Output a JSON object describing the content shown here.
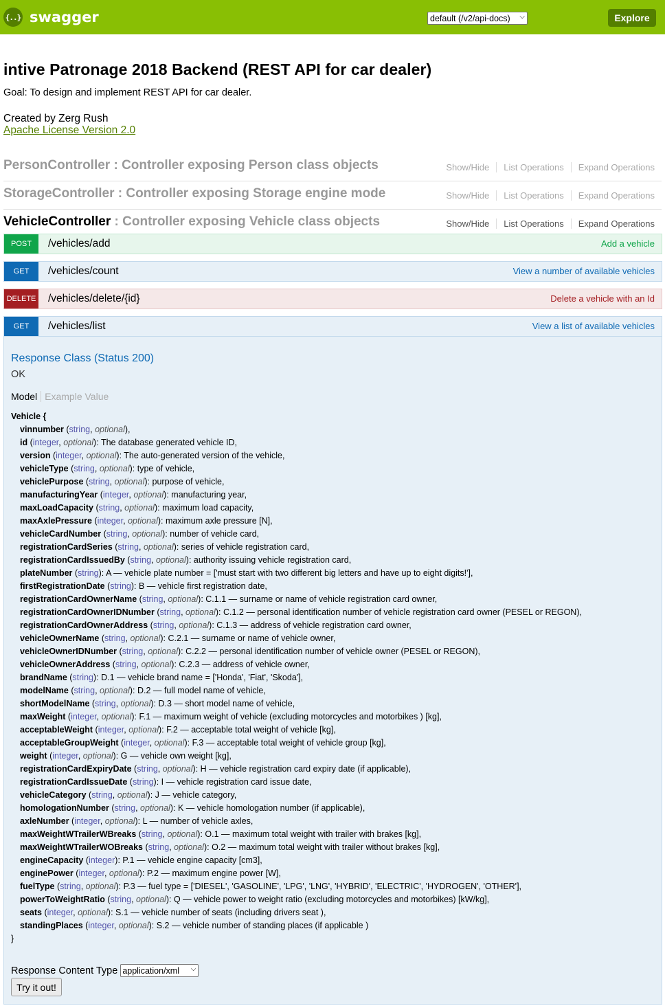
{
  "header": {
    "logo_icon_text": "{..}",
    "logo_text": "swagger",
    "api_select_value": "default (/v2/api-docs)",
    "explore_label": "Explore",
    "brand_color": "#89bf04"
  },
  "info": {
    "title": "intive Patronage 2018 Backend (REST API for car dealer)",
    "goal": "Goal: To design and implement REST API for car dealer.",
    "created_by": "Created by Zerg Rush",
    "license": "Apache License Version 2.0"
  },
  "controller_links": {
    "show_hide": "Show/Hide",
    "list_ops": "List Operations",
    "expand_ops": "Expand Operations"
  },
  "controllers": [
    {
      "name": "PersonController",
      "desc": " : Controller exposing Person class objects"
    },
    {
      "name": "StorageController",
      "desc": " : Controller exposing Storage engine mode"
    },
    {
      "name": "VehicleController",
      "desc": " : Controller exposing Vehicle class objects"
    }
  ],
  "operations": [
    {
      "method": "POST",
      "path": "/vehicles/add",
      "summary": "Add a vehicle"
    },
    {
      "method": "GET",
      "path": "/vehicles/count",
      "summary": "View a number of available vehicles"
    },
    {
      "method": "DELETE",
      "path": "/vehicles/delete/{id}",
      "summary": "Delete a vehicle with an Id"
    },
    {
      "method": "GET",
      "path": "/vehicles/list",
      "summary": "View a list of available vehicles"
    }
  ],
  "response": {
    "class_title": "Response Class (Status 200)",
    "status_text": "OK",
    "tab_model": "Model",
    "tab_example": "Example Value",
    "model_head": "Vehicle {",
    "model_close": "}",
    "content_type_label": "Response Content Type",
    "content_type_value": "application/xml",
    "try_label": "Try it out!"
  },
  "properties": [
    {
      "name": "vinnumber",
      "type": "string",
      "optional": true,
      "desc": ""
    },
    {
      "name": "id",
      "type": "integer",
      "optional": true,
      "desc": "The database generated vehicle ID"
    },
    {
      "name": "version",
      "type": "integer",
      "optional": true,
      "desc": "The auto-generated version of the vehicle"
    },
    {
      "name": "vehicleType",
      "type": "string",
      "optional": true,
      "desc": "type of vehicle"
    },
    {
      "name": "vehiclePurpose",
      "type": "string",
      "optional": true,
      "desc": "purpose of vehicle"
    },
    {
      "name": "manufacturingYear",
      "type": "integer",
      "optional": true,
      "desc": "manufacturing year"
    },
    {
      "name": "maxLoadCapacity",
      "type": "string",
      "optional": true,
      "desc": "maximum load capacity"
    },
    {
      "name": "maxAxlePressure",
      "type": "integer",
      "optional": true,
      "desc": "maximum axle pressure [N]"
    },
    {
      "name": "vehicleCardNumber",
      "type": "string",
      "optional": true,
      "desc": "number of vehicle card"
    },
    {
      "name": "registrationCardSeries",
      "type": "string",
      "optional": true,
      "desc": "series of vehicle registration card"
    },
    {
      "name": "registrationCardIssuedBy",
      "type": "string",
      "optional": true,
      "desc": "authority issuing vehicle registration card"
    },
    {
      "name": "plateNumber",
      "type": "string",
      "optional": false,
      "desc": "A — vehicle plate number = ['must start with two different big letters and have up to eight digits!']"
    },
    {
      "name": "firstRegistrationDate",
      "type": "string",
      "optional": false,
      "desc": "B — vehicle first registration date"
    },
    {
      "name": "registrationCardOwnerName",
      "type": "string",
      "optional": true,
      "desc": "C.1.1 — surname or name of vehicle registration card owner"
    },
    {
      "name": "registrationCardOwnerIDNumber",
      "type": "string",
      "optional": true,
      "desc": "C.1.2 — personal identification number of vehicle registration card owner (PESEL or REGON)"
    },
    {
      "name": "registrationCardOwnerAddress",
      "type": "string",
      "optional": true,
      "desc": "C.1.3 — address of vehicle registration card owner"
    },
    {
      "name": "vehicleOwnerName",
      "type": "string",
      "optional": true,
      "desc": "C.2.1 — surname or name of vehicle owner"
    },
    {
      "name": "vehicleOwnerIDNumber",
      "type": "string",
      "optional": true,
      "desc": "C.2.2 — personal identification number of vehicle owner (PESEL or REGON)"
    },
    {
      "name": "vehicleOwnerAddress",
      "type": "string",
      "optional": true,
      "desc": "C.2.3 — address of vehicle owner"
    },
    {
      "name": "brandName",
      "type": "string",
      "optional": false,
      "desc": "D.1 — vehicle brand name = ['Honda', 'Fiat', 'Skoda']"
    },
    {
      "name": "modelName",
      "type": "string",
      "optional": true,
      "desc": "D.2 — full model name of vehicle"
    },
    {
      "name": "shortModelName",
      "type": "string",
      "optional": true,
      "desc": "D.3 — short model name of vehicle"
    },
    {
      "name": "maxWeight",
      "type": "integer",
      "optional": true,
      "desc": "F.1 — maximum weight of vehicle (excluding motorcycles and motorbikes ) [kg]"
    },
    {
      "name": "acceptableWeight",
      "type": "integer",
      "optional": true,
      "desc": "F.2 — acceptable total weight of vehicle [kg]"
    },
    {
      "name": "acceptableGroupWeight",
      "type": "integer",
      "optional": true,
      "desc": "F.3 — acceptable total weight of vehicle group [kg]"
    },
    {
      "name": "weight",
      "type": "integer",
      "optional": true,
      "desc": "G — vehicle own weight [kg]"
    },
    {
      "name": "registrationCardExpiryDate",
      "type": "string",
      "optional": true,
      "desc": "H — vehicle registration card expiry date (if applicable)"
    },
    {
      "name": "registrationCardIssueDate",
      "type": "string",
      "optional": false,
      "desc": "I — vehicle registration card issue date"
    },
    {
      "name": "vehicleCategory",
      "type": "string",
      "optional": true,
      "desc": "J — vehicle category"
    },
    {
      "name": "homologationNumber",
      "type": "string",
      "optional": true,
      "desc": "K — vehicle homologation number (if applicable)"
    },
    {
      "name": "axleNumber",
      "type": "integer",
      "optional": true,
      "desc": "L — number of vehicle axles"
    },
    {
      "name": "maxWeightWTrailerWBreaks",
      "type": "string",
      "optional": true,
      "desc": "O.1 — maximum total weight with trailer with brakes [kg]"
    },
    {
      "name": "maxWeightWTrailerWOBreaks",
      "type": "string",
      "optional": true,
      "desc": "O.2 — maximum total weight with trailer without brakes [kg]"
    },
    {
      "name": "engineCapacity",
      "type": "integer",
      "optional": false,
      "desc": "P.1 — vehicle engine capacity [cm3]"
    },
    {
      "name": "enginePower",
      "type": "integer",
      "optional": true,
      "desc": "P.2 — maximum engine power [W]"
    },
    {
      "name": "fuelType",
      "type": "string",
      "optional": true,
      "desc": "P.3 — fuel type = ['DIESEL', 'GASOLINE', 'LPG', 'LNG', 'HYBRID', 'ELECTRIC', 'HYDROGEN', 'OTHER']"
    },
    {
      "name": "powerToWeightRatio",
      "type": "string",
      "optional": true,
      "desc": "Q — vehicle power to weight ratio (excluding motorcycles and motorbikes) [kW/kg]"
    },
    {
      "name": "seats",
      "type": "integer",
      "optional": true,
      "desc": "S.1 — vehicle number of seats (including drivers seat )"
    },
    {
      "name": "standingPlaces",
      "type": "integer",
      "optional": true,
      "desc": "S.2 — vehicle number of standing places (if applicable )"
    }
  ],
  "optional_word": "optional"
}
